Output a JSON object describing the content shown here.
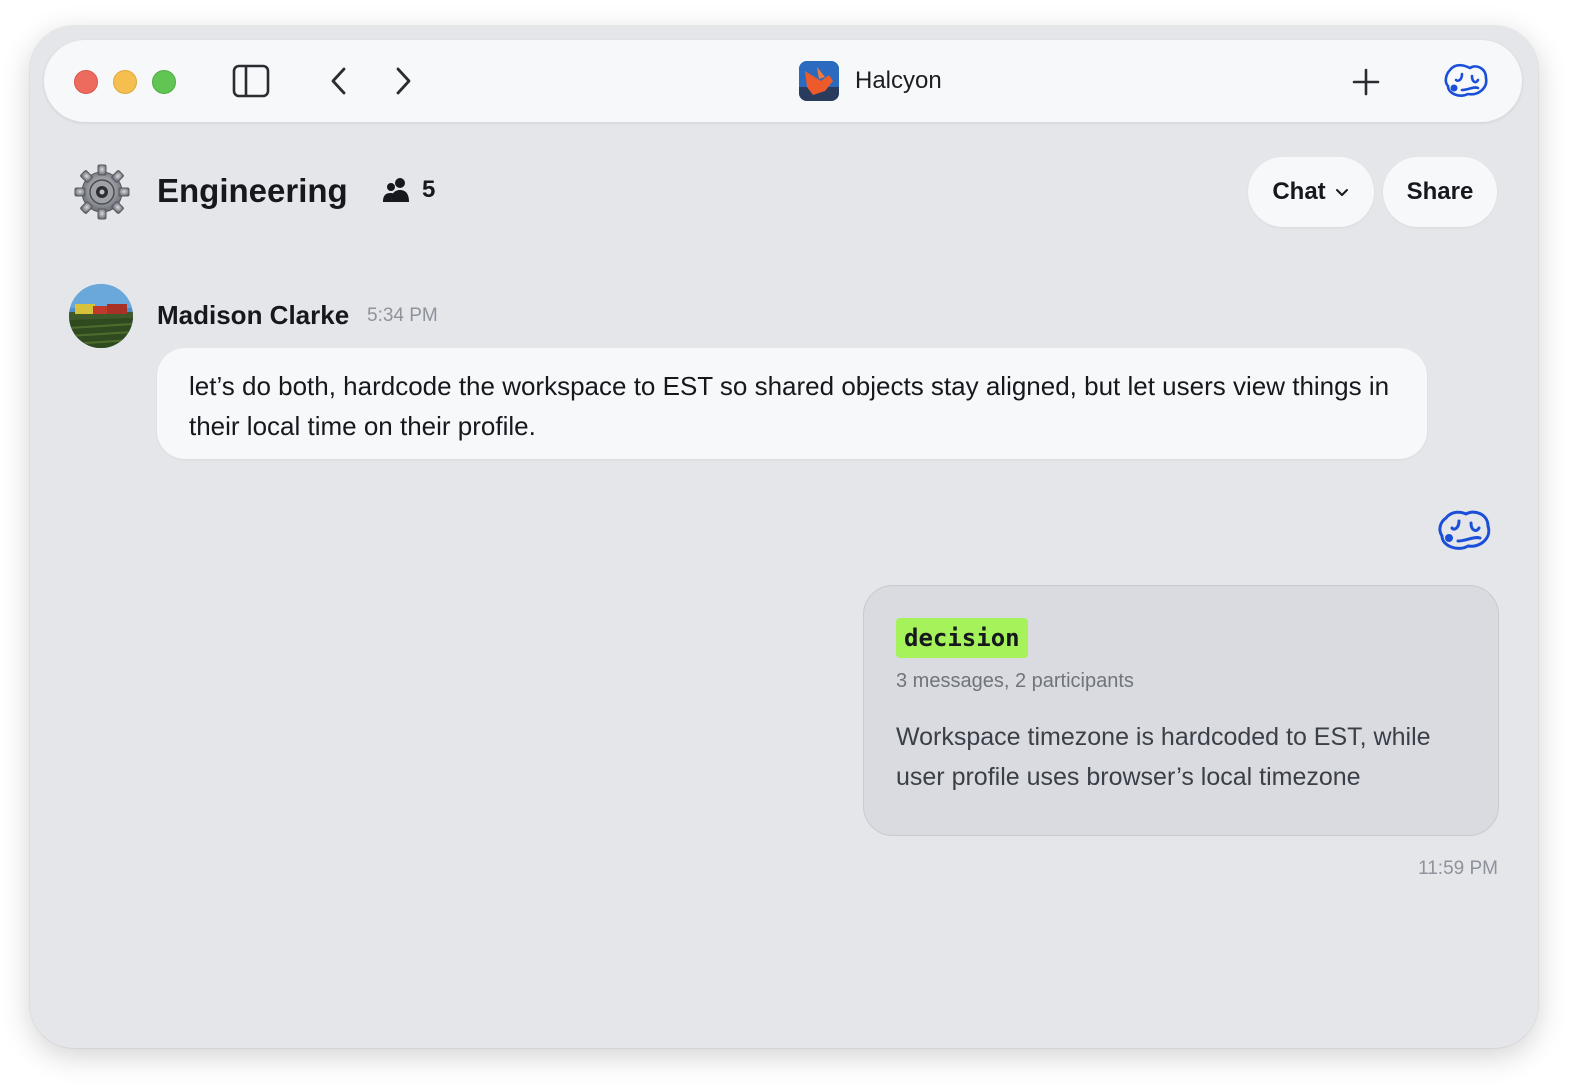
{
  "window": {
    "app_title": "Halcyon",
    "colors": {
      "accent": "#1b4fd8",
      "tag_bg": "#a6f25a",
      "window_bg": "#e5e6ea"
    }
  },
  "titlebar": {
    "icons": [
      "sidebar-toggle-icon",
      "chevron-left-icon",
      "chevron-right-icon",
      "plus-icon",
      "brand-icon"
    ]
  },
  "channel": {
    "name": "Engineering",
    "member_count": "5",
    "chat_button": "Chat",
    "share_button": "Share"
  },
  "messages": [
    {
      "author": "Madison Clarke",
      "time": "5:34 PM",
      "text": "let’s do both, hardcode the workspace to EST so shared objects stay aligned, but let users view things in their local time on their profile."
    }
  ],
  "summary_card": {
    "tag": "decision",
    "meta": "3 messages, 2 participants",
    "body": "Workspace timezone is hardcoded to EST, while user profile uses browser’s local timezone",
    "time": "11:59 PM"
  }
}
